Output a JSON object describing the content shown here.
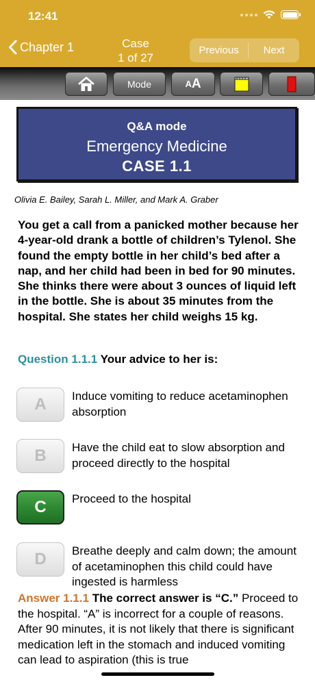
{
  "status": {
    "time": "12:41"
  },
  "nav": {
    "back_label": "Chapter 1",
    "case_line1": "Case",
    "case_line2": "1 of 27",
    "previous_label": "Previous",
    "next_label": "Next"
  },
  "toolbar": {
    "home_icon": "home-icon",
    "mode_label": "Mode",
    "font_small": "A",
    "font_big": "A",
    "highlight_color": "#ffff00",
    "bookmark_color": "#e01010"
  },
  "banner": {
    "mode": "Q&A mode",
    "subject": "Emergency Medicine",
    "case": "CASE 1.1"
  },
  "authors": "Olivia E. Bailey, Sarah L. Miller, and Mark A. Graber",
  "stem": "You get a call from a panicked mother because her 4-year-old drank a bottle of children’s Tylenol. She found the empty bottle in her child’s bed after a nap, and her child had been in bed for 90 minutes. She thinks there were about 3 ounces of liquid left in the bottle. She is about 35 minutes from the hospital. She states her child weighs 15 kg.",
  "question": {
    "number": "Question 1.1.1",
    "text": "Your advice to her is:"
  },
  "options": [
    {
      "letter": "A",
      "text": "Induce vomiting to reduce acetaminophen absorption"
    },
    {
      "letter": "B",
      "text": "Have the child eat to slow absorption and proceed directly to the hospital"
    },
    {
      "letter": "C",
      "text": "Proceed to the hospital"
    },
    {
      "letter": "D",
      "text": "Breathe deeply and calm down; the amount of acetaminophen this child could have ingested is harmless"
    }
  ],
  "selected_option": "C",
  "answer": {
    "number": "Answer 1.1.1",
    "lead": "The correct answer is “C.”",
    "text": "Proceed to the hospital. “A” is incorrect for a couple of reasons. After 90 minutes, it is not likely that there is significant medication left in the stomach and induced vomiting can lead to aspiration (this is true"
  },
  "colors": {
    "header_bg": "#d8a92c",
    "banner_bg": "#3d4988",
    "question_accent": "#2a8fa0",
    "answer_accent": "#d0742c",
    "selected_green": "#2e8a32"
  }
}
